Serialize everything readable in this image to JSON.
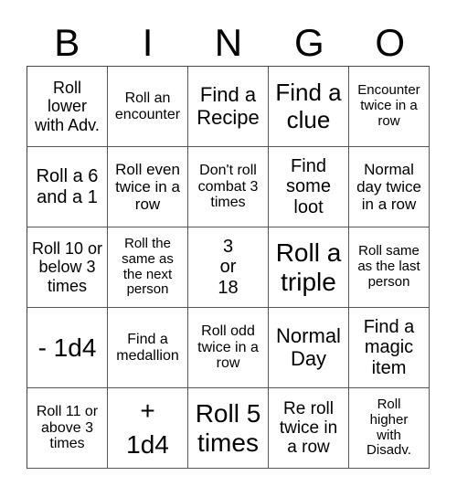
{
  "header": {
    "letters": [
      "B",
      "I",
      "N",
      "G",
      "O"
    ]
  },
  "cells": [
    "Roll lower with Adv.",
    "Roll an encounter",
    "Find a Recipe",
    "Find a clue",
    "Encounter twice in a row",
    "Roll a 6 and a 1",
    "Roll even twice in a row",
    "Don't roll combat 3 times",
    "Find some loot",
    "Normal day twice in a row",
    "Roll 10 or below 3 times",
    "Roll the same as the next person",
    "3 or 18",
    "Roll a triple",
    "Roll same as the last person",
    "- 1d4",
    "Find a medallion",
    "Roll odd twice in a row",
    "Normal Day",
    "Find a magic item",
    "Roll 11 or above 3 times",
    "+ 1d4",
    "Roll 5 times",
    "Re roll twice in a row",
    "Roll higher with Disadv."
  ]
}
